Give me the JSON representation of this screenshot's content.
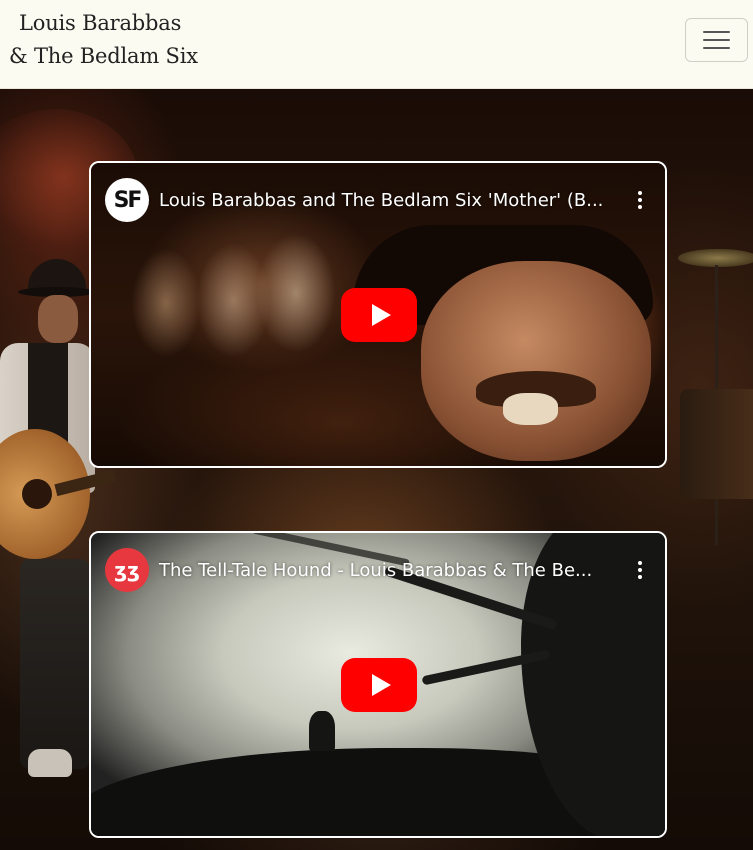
{
  "header": {
    "brand_line1": "Louis Barabbas",
    "brand_line2": "& The Bedlam Six",
    "menu_icon": "hamburger-menu-icon"
  },
  "videos": [
    {
      "title": "Louis Barabbas and The Bedlam Six 'Mother' (B...",
      "channel_avatar_text": "SF",
      "play_icon": "youtube-play-icon",
      "menu_icon": "more-vertical-icon"
    },
    {
      "title": "The Tell-Tale Hound - Louis Barabbas & The Be...",
      "channel_avatar_text": "ʒʒ",
      "play_icon": "youtube-play-icon",
      "menu_icon": "more-vertical-icon"
    }
  ],
  "colors": {
    "header_bg": "#fcfbf1",
    "play_button": "#ff0000",
    "video_border": "#ffffff"
  }
}
